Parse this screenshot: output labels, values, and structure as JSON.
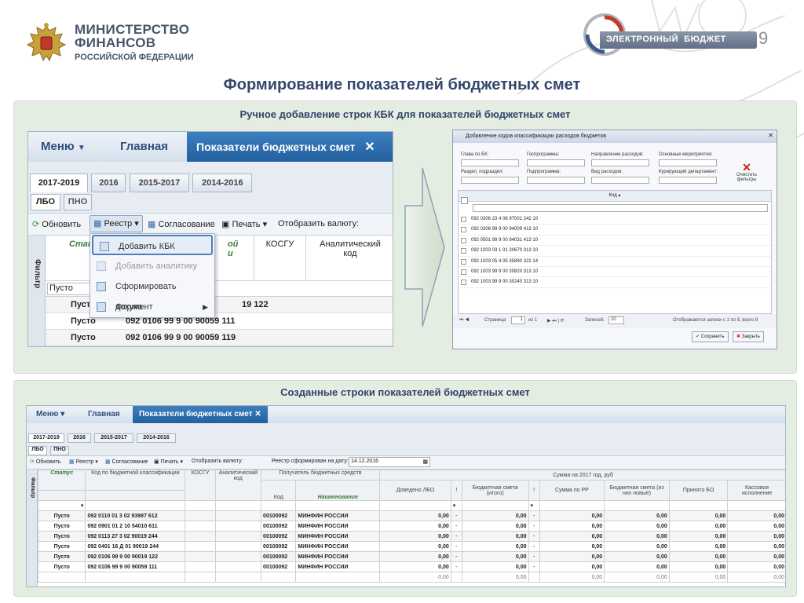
{
  "header": {
    "org_line1": "МИНИСТЕРСТВО",
    "org_line2": "ФИНАНСОВ",
    "org_line3": "РОССИЙСКОЙ ФЕДЕРАЦИИ",
    "brand": "ЭЛЕКТРОННЫЙ  БЮДЖЕТ",
    "page_number": "9"
  },
  "slide": {
    "title": "Формирование показателей бюджетных смет",
    "section1_title": "Ручное добавление строк КБК для показателей бюджетных смет",
    "section2_title": "Созданные строки показателей бюджетных смет"
  },
  "app": {
    "menu": "Меню",
    "home": "Главная",
    "active_tab": "Показатели бюджетных смет",
    "year_tabs": [
      "2017-2019",
      "2016",
      "2015-2017",
      "2014-2016"
    ],
    "sub_tabs": [
      "ЛБО",
      "ПНО"
    ],
    "toolbar": {
      "refresh": "Обновить",
      "registry": "Реестр",
      "approval": "Согласование",
      "print": "Печать",
      "currency": "Отобразить валюту:"
    },
    "filter_label": "Фильтр",
    "col_status": "Статус",
    "col_code_partial": "ой",
    "col_code_partial2": "и",
    "col_kosgu": "КОСГУ",
    "col_analytic": "Аналитический код",
    "filter_value": "Пусто",
    "rows": [
      {
        "status": "Пусто",
        "code": "092 0106 99 9 00 90019 122",
        "code_partial": "19 122"
      },
      {
        "status": "Пусто",
        "code": "092 0106 99 9 00 90059 111"
      },
      {
        "status": "Пусто",
        "code": "092 0106 99 9 00 90059 119"
      }
    ],
    "context_menu": [
      "Добавить КБК",
      "Добавить аналитику",
      "Сформировать документ",
      "Форма"
    ]
  },
  "dialog": {
    "title": "Добавление кодов классификации расходов бюджетов",
    "filters": [
      "Глава по БК:",
      "Госпрограмма:",
      "Направление расходов:",
      "Основные мероприятия:",
      "Раздел, подраздел:",
      "Подпрограмма:",
      "Вид расходов:",
      "Курирующий департамент:"
    ],
    "clear_filters": "Очистить фильтры",
    "col_code": "Код",
    "codes": [
      "092 0306 23 4 08 97001 242 10",
      "092 0306 99 9 00 94009 413 10",
      "092 0501 99 9 00 94031 413 10",
      "092 1003 03 1 01 30670 313 10",
      "092 1003 05 4 05 35890 322 14",
      "092 1003 99 9 00 30820 313 10",
      "092 1003 99 9 00 30240 313 10"
    ],
    "pager_page": "Страница",
    "pager_value": "1",
    "pager_of": "из 1",
    "pager_records": "Записей:",
    "pager_records_value": "20",
    "pager_info": "Отображаются записи с 1 по 8, всего 8",
    "save": "Сохранить",
    "close": "Закрыть"
  },
  "bottom": {
    "menu": "Меню",
    "home": "Главная",
    "active_tab": "Показатели бюджетных смет",
    "year_tabs": [
      "2017-2019",
      "2016",
      "2015-2017",
      "2014-2016"
    ],
    "sub_tabs": [
      "ЛБО",
      "ПНО"
    ],
    "toolbar": {
      "refresh": "Обновить",
      "registry": "Реестр",
      "approval": "Согласование",
      "print": "Печать",
      "currency": "Отобразить валюту:"
    },
    "registry_label": "Реестр сформирован на дату:",
    "registry_date": "14.12.2016",
    "filter_label": "Фильтр",
    "headers": {
      "status": "Статус",
      "code": "Код по бюджетной классификации",
      "kosgu": "КОСГУ",
      "analytic": "Аналитический код",
      "recipient": "Получатель бюджетных средств",
      "rec_code": "Код",
      "rec_name": "Наименование",
      "sum_group": "Сумма на 2017 год, руб",
      "lbo": "Доведено ЛБО",
      "bud": "Бюджетная смета (итого)",
      "rr": "Сумма по РР",
      "bud_new": "Бюджетная смета (из них новые)",
      "bo": "Принято БО",
      "cash": "Кассовое исполнение"
    },
    "rows": [
      {
        "status": "Пусто",
        "code": "092 0110 01 3 02 93987 612",
        "rc": "00100092",
        "rn": "МИНФИН РОССИИ"
      },
      {
        "status": "Пусто",
        "code": "092 0901 01 2 10 54010 611",
        "rc": "00100092",
        "rn": "МИНФИН РОССИИ"
      },
      {
        "status": "Пусто",
        "code": "092 0113 27 3 02 90019 244",
        "rc": "00100092",
        "rn": "МИНФИН РОССИИ"
      },
      {
        "status": "Пусто",
        "code": "092 0401 16 Д 01 90019 244",
        "rc": "00100092",
        "rn": "МИНФИН РОССИИ"
      },
      {
        "status": "Пусто",
        "code": "092 0106 99 9 00 90019 122",
        "rc": "00100092",
        "rn": "МИНФИН РОССИИ"
      },
      {
        "status": "Пусто",
        "code": "092 0106 99 9 00 90059 111",
        "rc": "00100092",
        "rn": "МИНФИН РОССИИ"
      }
    ],
    "zero": "0,00",
    "dash": "-"
  }
}
